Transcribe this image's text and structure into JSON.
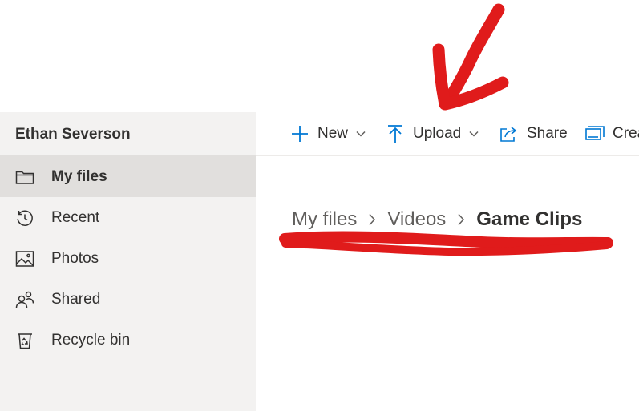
{
  "sidebar": {
    "user_name": "Ethan Severson",
    "items": [
      {
        "label": "My files",
        "icon": "folder-icon",
        "active": true
      },
      {
        "label": "Recent",
        "icon": "clock-history-icon",
        "active": false
      },
      {
        "label": "Photos",
        "icon": "photo-icon",
        "active": false
      },
      {
        "label": "Shared",
        "icon": "people-icon",
        "active": false
      },
      {
        "label": "Recycle bin",
        "icon": "recycle-bin-icon",
        "active": false
      }
    ]
  },
  "toolbar": {
    "new_label": "New",
    "upload_label": "Upload",
    "share_label": "Share",
    "create_label": "Crea"
  },
  "breadcrumb": {
    "items": [
      "My files",
      "Videos",
      "Game Clips"
    ]
  },
  "colors": {
    "accent": "#0078d4",
    "annotation": "#e01b1b",
    "sidebar_bg": "#f3f2f1",
    "active_bg": "#e1dfdd"
  }
}
